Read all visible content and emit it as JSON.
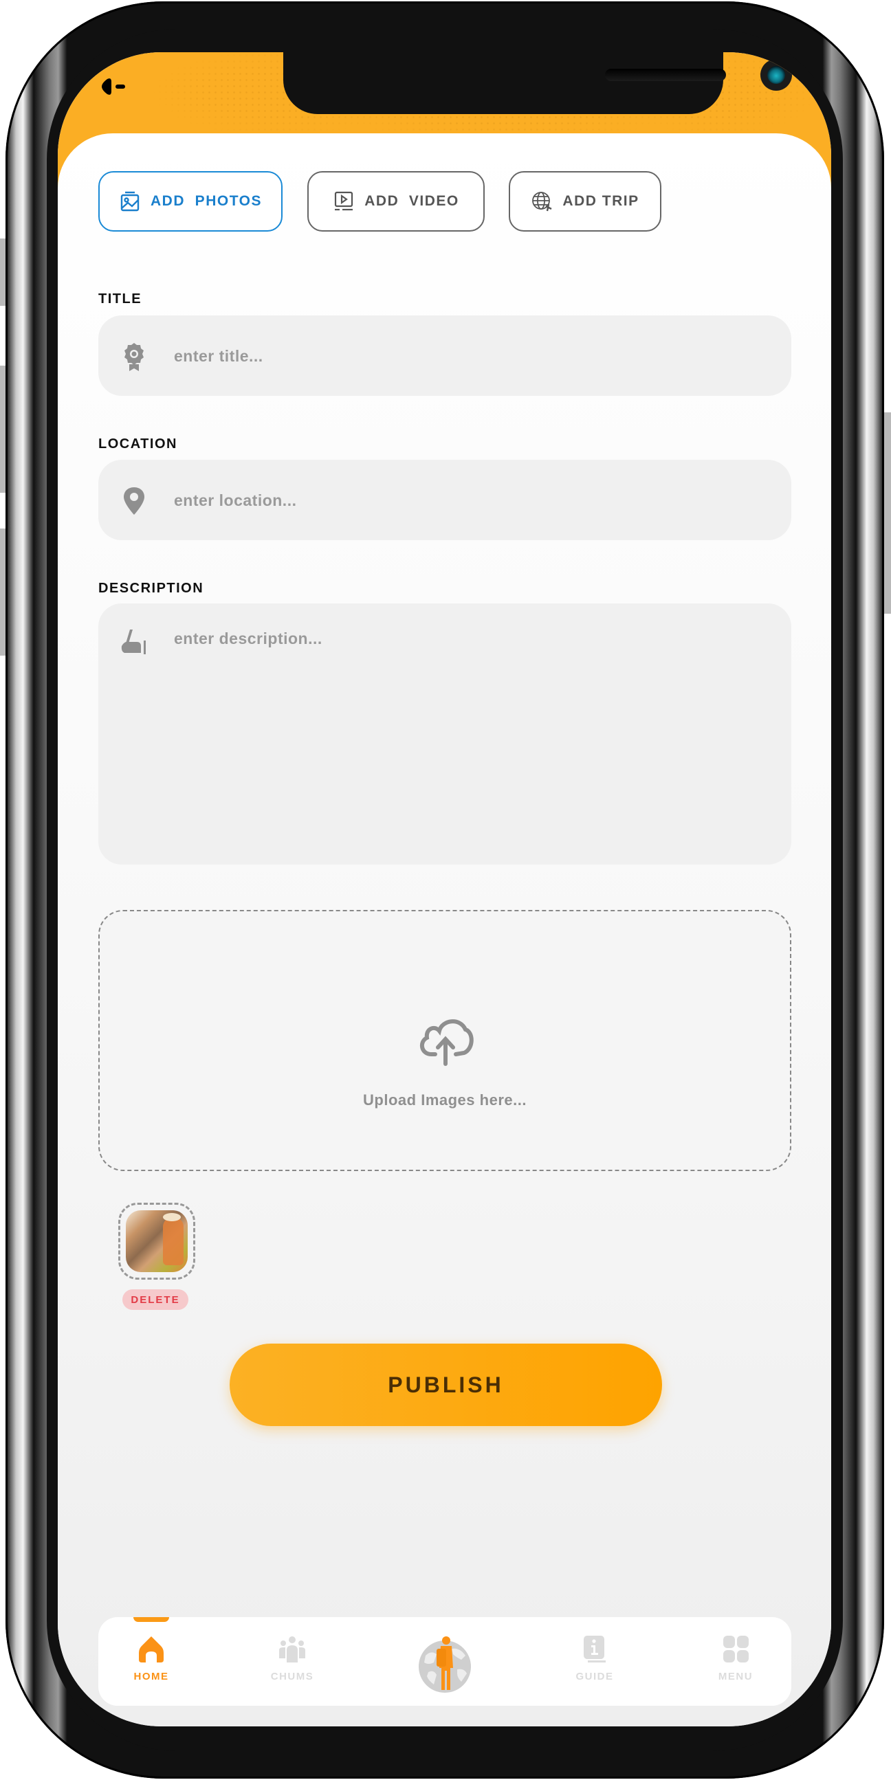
{
  "header": {
    "back_icon": "back-arrow-icon",
    "accent_color": "#fbae24"
  },
  "media_tabs": [
    {
      "label": "ADD  PHOTOS",
      "icon": "image-icon",
      "active": true
    },
    {
      "label": "ADD  VIDEO",
      "icon": "video-icon",
      "active": false
    },
    {
      "label": "ADD TRIP",
      "icon": "globe-plane-icon",
      "active": false
    }
  ],
  "form": {
    "title": {
      "label": "TITLE",
      "value": "",
      "placeholder": "enter title...",
      "icon": "award-badge-icon"
    },
    "location": {
      "label": "LOCATION",
      "value": "",
      "placeholder": "enter location...",
      "icon": "map-pin-icon"
    },
    "description": {
      "label": "DESCRIPTION",
      "value": "",
      "placeholder": "enter description...",
      "icon": "writing-hand-icon"
    }
  },
  "upload": {
    "icon": "cloud-upload-icon",
    "text": "Upload Images here..."
  },
  "thumbnails": [
    {
      "delete_label": "DELETE"
    }
  ],
  "publish": {
    "label": "PUBLISH",
    "color": "#fea300"
  },
  "nav": {
    "items": [
      {
        "label": "HOME",
        "icon": "home-icon",
        "active": true
      },
      {
        "label": "CHUMS",
        "icon": "people-icon",
        "active": false
      },
      {
        "label": "",
        "icon": "traveler-globe-icon",
        "active": false
      },
      {
        "label": "GUIDE",
        "icon": "info-book-icon",
        "active": false
      },
      {
        "label": "MENU",
        "icon": "grid-menu-icon",
        "active": false
      }
    ],
    "active_color": "#fb9216",
    "inactive_color": "#dcdcdc"
  }
}
